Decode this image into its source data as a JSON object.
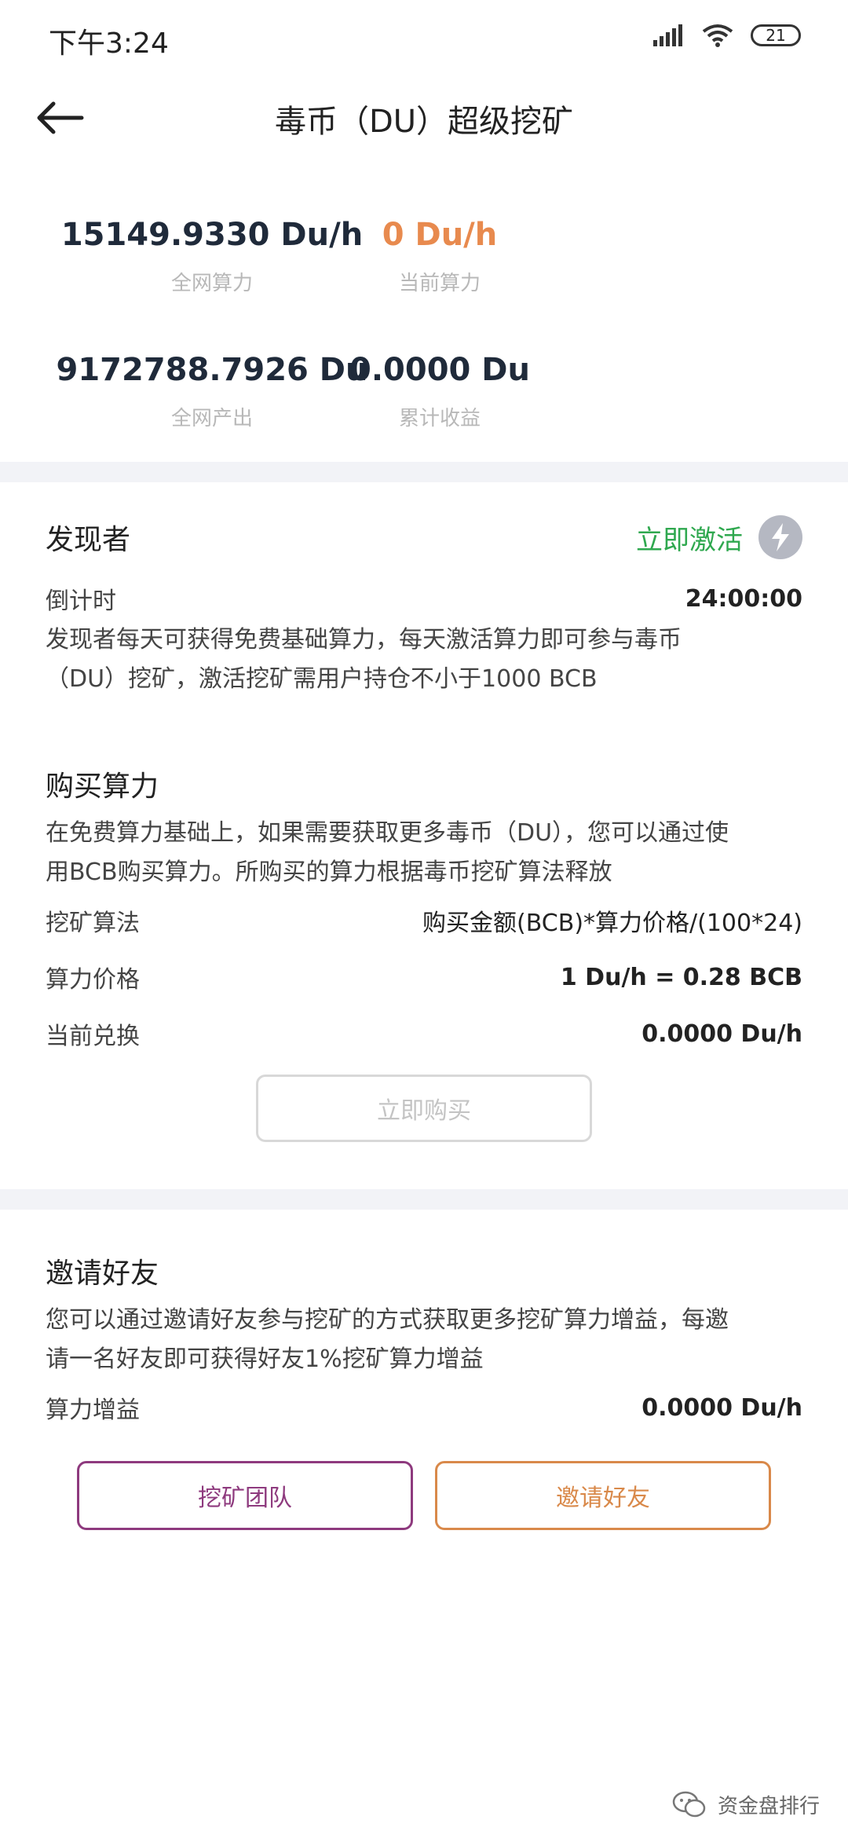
{
  "status_bar": {
    "time": "下午3:24",
    "battery": "21"
  },
  "header": {
    "title": "毒币（DU）超级挖矿"
  },
  "stats": {
    "network_hashrate": {
      "value": "15149.9330 Du/h",
      "label": "全网算力"
    },
    "current_hashrate": {
      "value": "0 Du/h",
      "label": "当前算力"
    },
    "network_output": {
      "value": "9172788.7926 Du",
      "label": "全网产出"
    },
    "total_earnings": {
      "value": "0.0000 Du",
      "label": "累计收益"
    }
  },
  "discoverer": {
    "title": "发现者",
    "activate_label": "立即激活",
    "countdown_label": "倒计时",
    "countdown_value": "24:00:00",
    "description_line1": "发现者每天可获得免费基础算力，每天激活算力即可参与毒币",
    "description_line2": "（DU）挖矿，激活挖矿需用户持仓不小于1000 BCB"
  },
  "purchase": {
    "title": "购买算力",
    "description_line1": "在免费算力基础上，如果需要获取更多毒币（DU），您可以通过使",
    "description_line2": "用BCB购买算力。所购买的算力根据毒币挖矿算法释放",
    "algorithm_label": "挖矿算法",
    "algorithm_value": "购买金额(BCB)*算力价格/(100*24)",
    "price_label": "算力价格",
    "price_value": "1 Du/h = 0.28 BCB",
    "exchange_label": "当前兑换",
    "exchange_value": "0.0000 Du/h",
    "buy_button": "立即购买"
  },
  "invite": {
    "title": "邀请好友",
    "description_line1": "您可以通过邀请好友参与挖矿的方式获取更多挖矿算力增益，每邀",
    "description_line2": "请一名好友即可获得好友1%挖矿算力增益",
    "gain_label": "算力增益",
    "gain_value": "0.0000 Du/h",
    "team_button": "挖矿团队",
    "invite_button": "邀请好友"
  },
  "watermark": {
    "text": "资金盘排行"
  },
  "colors": {
    "accent_orange": "#e88a4e",
    "activate_green": "#2fa84f",
    "team_purple": "#8e3a7e",
    "invite_orange": "#d9894a"
  }
}
